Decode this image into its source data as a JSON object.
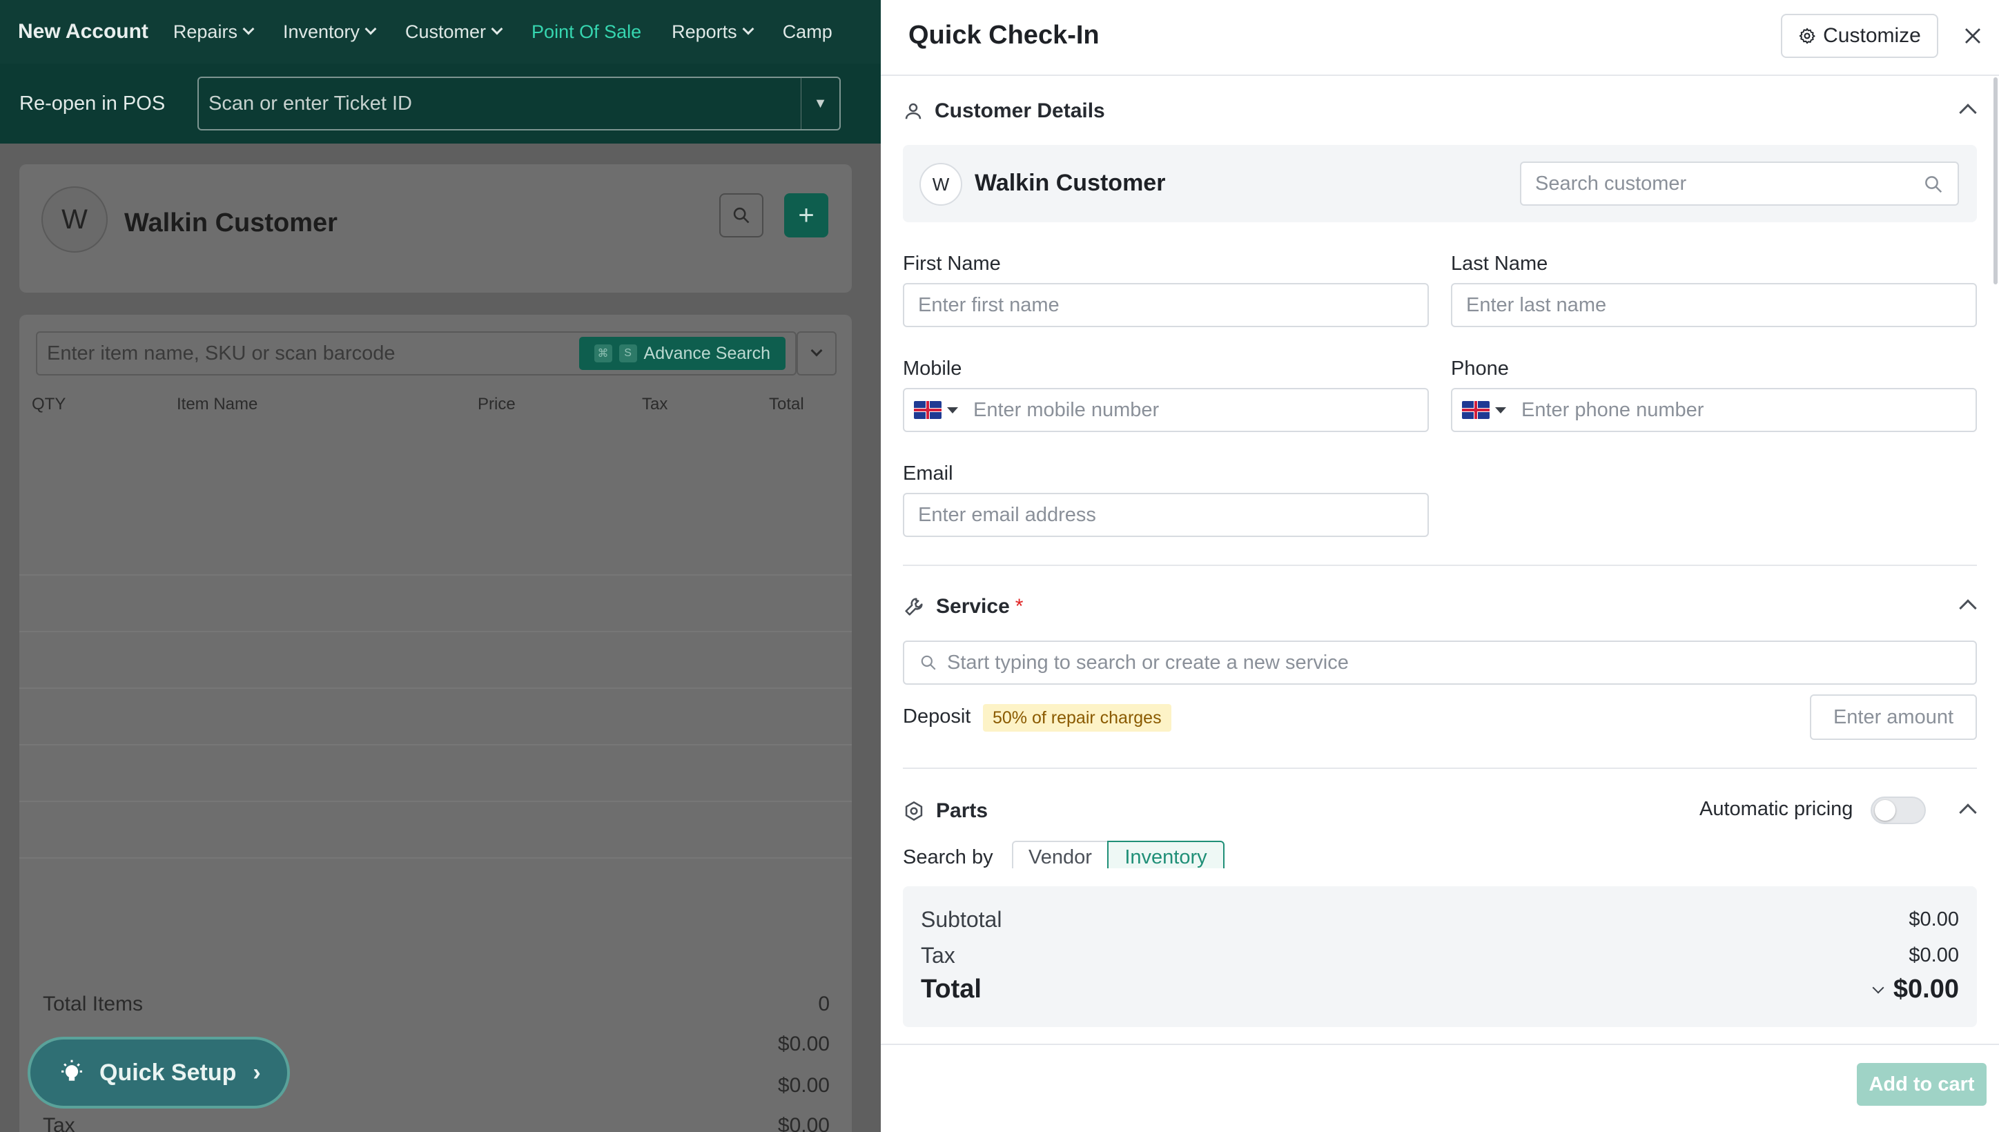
{
  "topnav": {
    "brand": "New Account",
    "items": [
      {
        "label": "Repairs"
      },
      {
        "label": "Inventory"
      },
      {
        "label": "Customer"
      },
      {
        "label": "Point Of Sale"
      },
      {
        "label": "Reports"
      },
      {
        "label": "Camp"
      }
    ],
    "active_color": "#36d6b0"
  },
  "subbar": {
    "label": "Re-open in POS",
    "ticket_placeholder": "Scan or enter Ticket ID"
  },
  "pos": {
    "customer": {
      "initial": "W",
      "name": "Walkin Customer"
    },
    "item_search_placeholder": "Enter item name, SKU or scan barcode",
    "advance_search": {
      "label": "Advance Search",
      "shortcut": [
        "⌘",
        "S"
      ]
    },
    "columns": [
      "QTY",
      "Item Name",
      "Price",
      "Tax",
      "Total"
    ],
    "totals": {
      "total_items_label": "Total Items",
      "total_items_value": "0",
      "row2_value": "$0.00",
      "row3_value": "$0.00",
      "tax_label": "Tax",
      "tax_value": "$0.00"
    },
    "quick_setup_label": "Quick Setup"
  },
  "drawer": {
    "title": "Quick Check-In",
    "customize_label": "Customize",
    "customer_details": {
      "title": "Customer Details",
      "selected": {
        "initial": "W",
        "name": "Walkin Customer"
      },
      "search_placeholder": "Search customer",
      "first_name": {
        "label": "First Name",
        "placeholder": "Enter first name"
      },
      "last_name": {
        "label": "Last Name",
        "placeholder": "Enter last name"
      },
      "mobile": {
        "label": "Mobile",
        "placeholder": "Enter mobile number",
        "country": "GB"
      },
      "phone": {
        "label": "Phone",
        "placeholder": "Enter phone number",
        "country": "GB"
      },
      "email": {
        "label": "Email",
        "placeholder": "Enter email address"
      }
    },
    "service": {
      "title": "Service",
      "required_mark": "*",
      "search_placeholder": "Start typing to search or create a new service",
      "deposit_label": "Deposit",
      "deposit_badge": "50% of repair charges",
      "amount_placeholder": "Enter amount"
    },
    "parts": {
      "title": "Parts",
      "automatic_pricing_label": "Automatic pricing",
      "automatic_pricing_enabled": false,
      "search_by_label": "Search by",
      "search_by_options": [
        "Vendor",
        "Inventory"
      ],
      "search_by_selected": "Inventory"
    },
    "summary": {
      "subtotal_label": "Subtotal",
      "subtotal_value": "$0.00",
      "tax_label": "Tax",
      "tax_value": "$0.00",
      "total_label": "Total",
      "total_value": "$0.00"
    },
    "add_to_cart_label": "Add to cart"
  }
}
